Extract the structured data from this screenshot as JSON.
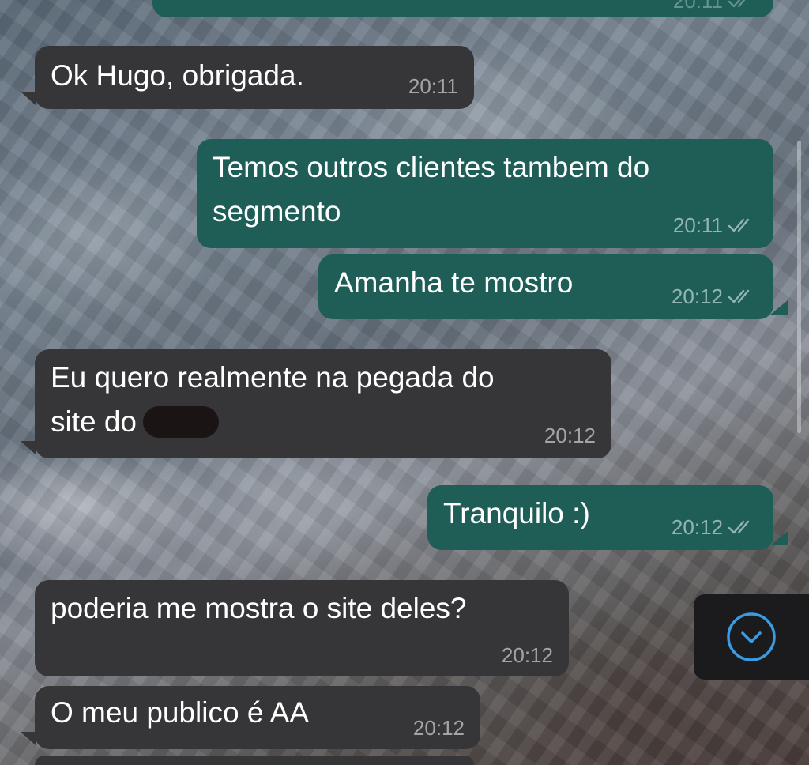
{
  "chat": {
    "messages": [
      {
        "direction": "out",
        "text": "",
        "time": "20:11",
        "status": "read"
      },
      {
        "direction": "in",
        "text": "Ok Hugo, obrigada.",
        "time": "20:11"
      },
      {
        "direction": "out",
        "line1": "Temos outros clientes tambem do",
        "line2": "segmento",
        "time": "20:11",
        "status": "read"
      },
      {
        "direction": "out",
        "text": "Amanha te mostro",
        "time": "20:12",
        "status": "read"
      },
      {
        "direction": "in",
        "line1": "Eu quero realmente na pegada do",
        "line2": "site do",
        "time": "20:12",
        "redacted": true
      },
      {
        "direction": "out",
        "text": "Tranquilo :)",
        "time": "20:12",
        "status": "read"
      },
      {
        "direction": "in",
        "text": "poderia me mostra o site deles?",
        "time": "20:12"
      },
      {
        "direction": "in",
        "text": "O meu publico é AA",
        "time": "20:12"
      }
    ]
  },
  "icons": {
    "read_ticks": "double-check-icon",
    "scroll_down": "chevron-down-circle-icon"
  },
  "colors": {
    "incoming_bubble": "#363638",
    "outgoing_bubble": "#1f5d57",
    "accent": "#3a9be0"
  }
}
